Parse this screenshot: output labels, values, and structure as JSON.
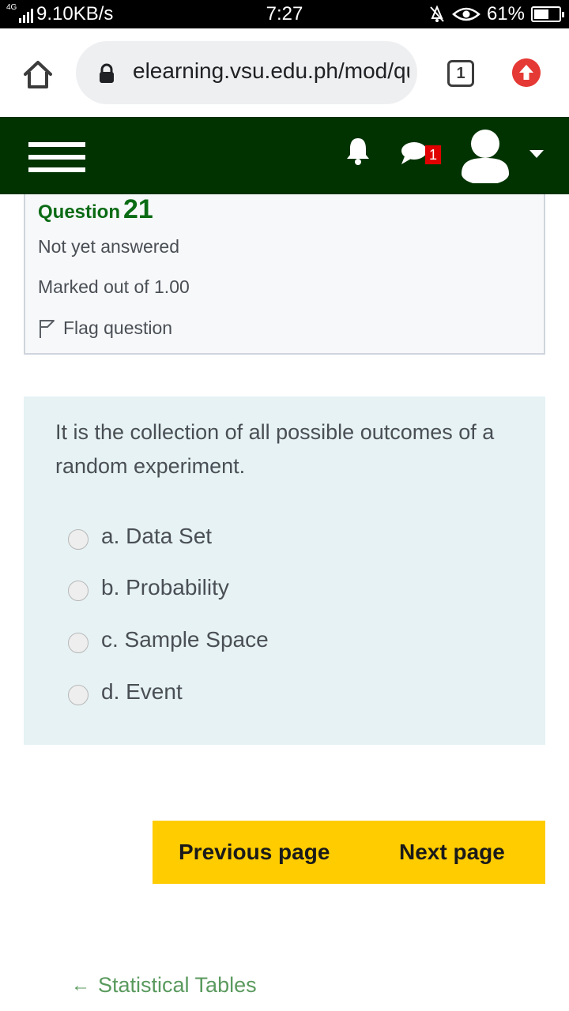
{
  "status_bar": {
    "network": "4G",
    "speed": "9.10KB/s",
    "time": "7:27",
    "battery": "61%",
    "battery_level": 0.61
  },
  "browser": {
    "url": "elearning.vsu.edu.ph/mod/quiz/attempt.php",
    "tab_count": "1"
  },
  "navbar": {
    "bg_color": "#003300",
    "message_badge": "1"
  },
  "question": {
    "label": "Question",
    "number": "21",
    "state": "Not yet answered",
    "grade": "Marked out of 1.00",
    "flag_label": "Flag question",
    "text": "It is the collection of all possible outcomes of a random experiment.",
    "options": [
      {
        "label": "a. Data Set",
        "selected": false
      },
      {
        "label": "b. Probability",
        "selected": false
      },
      {
        "label": "c. Sample Space",
        "selected": false
      },
      {
        "label": "d. Event",
        "selected": false
      }
    ]
  },
  "navigation": {
    "previous": "Previous page",
    "next": "Next page",
    "prev_activity": "Statistical Tables",
    "button_color": "#ffcc00"
  }
}
